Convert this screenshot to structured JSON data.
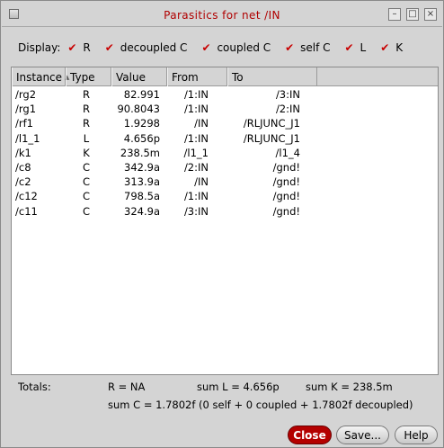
{
  "window": {
    "title": "Parasitics for net /IN",
    "controls": [
      "–",
      "□",
      "×"
    ]
  },
  "display": {
    "label": "Display:",
    "options": [
      {
        "label": "R",
        "checked": true
      },
      {
        "label": "decoupled C",
        "checked": true
      },
      {
        "label": "coupled C",
        "checked": true
      },
      {
        "label": "self C",
        "checked": true
      },
      {
        "label": "L",
        "checked": true
      },
      {
        "label": "K",
        "checked": true
      }
    ]
  },
  "table": {
    "columns": [
      "Instance",
      "Type",
      "Value",
      "From",
      "To"
    ],
    "sort_indicator": "▲",
    "rows": [
      [
        "/rg2",
        "R",
        "82.991",
        "/1:IN",
        "/3:IN"
      ],
      [
        "/rg1",
        "R",
        "90.8043",
        "/1:IN",
        "/2:IN"
      ],
      [
        "/rf1",
        "R",
        "1.9298",
        "/IN",
        "/RLJUNC_J1"
      ],
      [
        "/l1_1",
        "L",
        "4.656p",
        "/1:IN",
        "/RLJUNC_J1"
      ],
      [
        "/k1",
        "K",
        "238.5m",
        "/l1_1",
        "/l1_4"
      ],
      [
        "/c8",
        "C",
        "342.9a",
        "/2:IN",
        "/gnd!"
      ],
      [
        "/c2",
        "C",
        "313.9a",
        "/IN",
        "/gnd!"
      ],
      [
        "/c12",
        "C",
        "798.5a",
        "/1:IN",
        "/gnd!"
      ],
      [
        "/c11",
        "C",
        "324.9a",
        "/3:IN",
        "/gnd!"
      ]
    ]
  },
  "totals": {
    "label": "Totals:",
    "r": "R = NA",
    "l": "sum L = 4.656p",
    "k": "sum K = 238.5m",
    "c": "sum C = 1.7802f (0 self + 0 coupled + 1.7802f decoupled)"
  },
  "buttons": {
    "close": "Close",
    "save": "Save...",
    "help": "Help"
  },
  "colors": {
    "title": "#b00000",
    "check": "#c80000",
    "close_button": "#b40000"
  }
}
